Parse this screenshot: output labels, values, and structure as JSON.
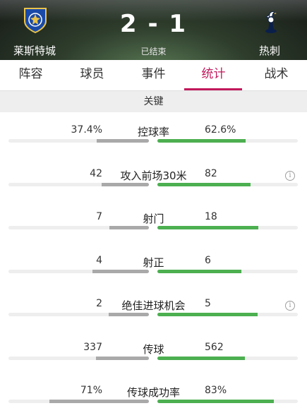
{
  "match": {
    "home_team": "莱斯特城",
    "away_team": "热刺",
    "home_score": "2",
    "away_score": "1",
    "score_separator": "-",
    "status": "已结束"
  },
  "tabs": [
    {
      "label": "阵容",
      "active": false
    },
    {
      "label": "球员",
      "active": false
    },
    {
      "label": "事件",
      "active": false
    },
    {
      "label": "统计",
      "active": true
    },
    {
      "label": "战术",
      "active": false
    }
  ],
  "section": {
    "title": "关键"
  },
  "stats": [
    {
      "label": "控球率",
      "home": "37.4%",
      "away": "62.6%",
      "home_share": 0.374,
      "away_share": 0.626,
      "info": false
    },
    {
      "label": "攻入前场30米",
      "home": "42",
      "away": "82",
      "home_share": 0.339,
      "away_share": 0.661,
      "info": true
    },
    {
      "label": "射门",
      "home": "7",
      "away": "18",
      "home_share": 0.28,
      "away_share": 0.72,
      "info": false
    },
    {
      "label": "射正",
      "home": "4",
      "away": "6",
      "home_share": 0.4,
      "away_share": 0.6,
      "info": false
    },
    {
      "label": "绝佳进球机会",
      "home": "2",
      "away": "5",
      "home_share": 0.286,
      "away_share": 0.714,
      "info": true
    },
    {
      "label": "传球",
      "home": "337",
      "away": "562",
      "home_share": 0.375,
      "away_share": 0.625,
      "info": false
    },
    {
      "label": "传球成功率",
      "home": "71%",
      "away": "83%",
      "home_share": 0.71,
      "away_share": 0.83,
      "info": false
    }
  ],
  "colors": {
    "accent": "#c2185b",
    "home_bar": "#a9a9a9",
    "away_bar": "#4caf50",
    "track": "#eeeeee"
  },
  "icons": {
    "home_crest": "leicester-crest-icon",
    "away_crest": "tottenham-crest-icon",
    "info": "info-icon"
  }
}
